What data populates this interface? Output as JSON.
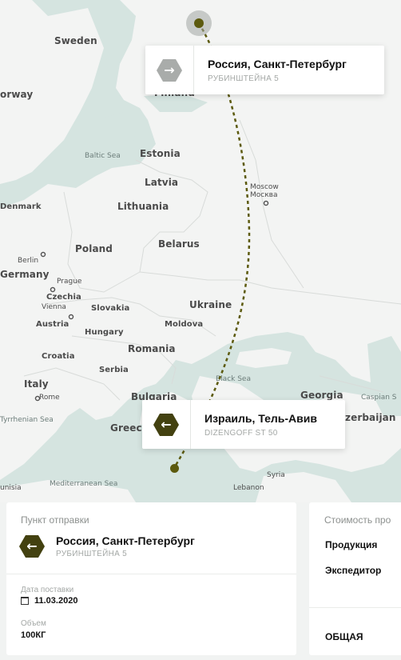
{
  "map": {
    "countries": [
      "Sweden",
      "orway",
      "Finland",
      "Estonia",
      "Latvia",
      "Lithuania",
      "Denmark",
      "Poland",
      "Belarus",
      "Germany",
      "Czechia",
      "Slovakia",
      "Austria",
      "Hungary",
      "Moldova",
      "Ukraine",
      "Romania",
      "Croatia",
      "Serbia",
      "Italy",
      "Bulgaria",
      "Greece",
      "Georgia",
      "zerbaijan"
    ],
    "seas": [
      "Baltic Sea",
      "Black Sea",
      "Mediterranean Sea",
      "Tyrrhenian Sea",
      "Caspian S"
    ],
    "cities": [
      "Moscow",
      "Москва",
      "Berlin",
      "Prague",
      "Vienna",
      "Rome",
      "Lebanon",
      "Syria",
      "unisia"
    ]
  },
  "route": {
    "color": "#5c5a0e",
    "origin": {
      "title": "Россия, Санкт-Петербург",
      "address": "РУБИНШТЕЙНА 5",
      "icon": "arrow-right-icon",
      "icon_color": "#a9acaa"
    },
    "destination": {
      "title": "Израиль, Тель-Авив",
      "address": "DIZENGOFF ST 50",
      "icon": "arrow-left-icon",
      "icon_color": "#434110"
    }
  },
  "shipment": {
    "header": "Пункт отправки",
    "from_title": "Россия, Санкт-Петербург",
    "from_address": "РУБИНШТЕЙНА 5",
    "date_label": "Дата поставки",
    "date_value": "11.03.2020",
    "volume_label": "Объем",
    "volume_value": "100КГ"
  },
  "cost": {
    "header": "Стоимость про",
    "rows": [
      "Продукция",
      "Экспедитор"
    ],
    "total_label": "ОБЩАЯ"
  }
}
